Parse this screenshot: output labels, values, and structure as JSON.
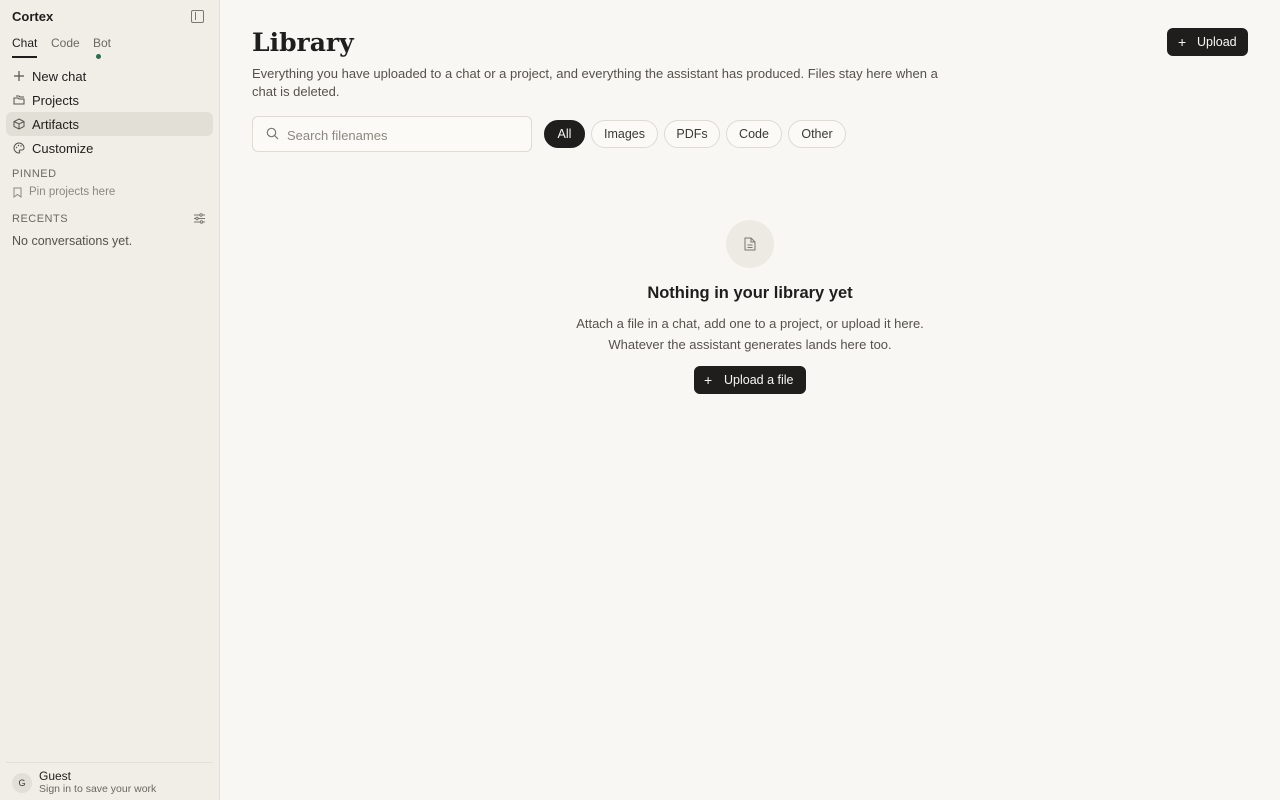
{
  "app": {
    "name": "Cortex"
  },
  "sidebar": {
    "mode_tabs": [
      {
        "label": "Chat",
        "active": true
      },
      {
        "label": "Code",
        "active": false
      },
      {
        "label": "Bot",
        "active": false,
        "status_dot": true
      }
    ],
    "nav": [
      {
        "label": "New chat",
        "icon": "plus-icon",
        "active": false
      },
      {
        "label": "Projects",
        "icon": "folders-icon",
        "active": false
      },
      {
        "label": "Artifacts",
        "icon": "box-icon",
        "active": true
      },
      {
        "label": "Customize",
        "icon": "palette-icon",
        "active": false
      }
    ],
    "pinned": {
      "label": "PINNED",
      "hint": "Pin projects here"
    },
    "recents": {
      "label": "RECENTS",
      "empty": "No conversations yet."
    },
    "user": {
      "initial": "G",
      "name": "Guest",
      "subtitle": "Sign in to save your work"
    }
  },
  "main": {
    "title": "Library",
    "description": "Everything you have uploaded to a chat or a project, and everything the assistant has produced. Files stay here when a chat is deleted.",
    "upload_label": "Upload",
    "search": {
      "placeholder": "Search filenames",
      "value": ""
    },
    "filters": [
      {
        "label": "All",
        "active": true
      },
      {
        "label": "Images",
        "active": false
      },
      {
        "label": "PDFs",
        "active": false
      },
      {
        "label": "Code",
        "active": false
      },
      {
        "label": "Other",
        "active": false
      }
    ],
    "empty_state": {
      "icon": "document-icon",
      "title": "Nothing in your library yet",
      "line1": "Attach a file in a chat, add one to a project, or upload it here.",
      "line2": "Whatever the assistant generates lands here too.",
      "button_label": "Upload a file"
    }
  },
  "colors": {
    "accent": "#1f1e1c",
    "status_dot": "#2f6b4a",
    "sidebar_bg": "#f0eee7",
    "page_bg": "#f8f7f3"
  }
}
